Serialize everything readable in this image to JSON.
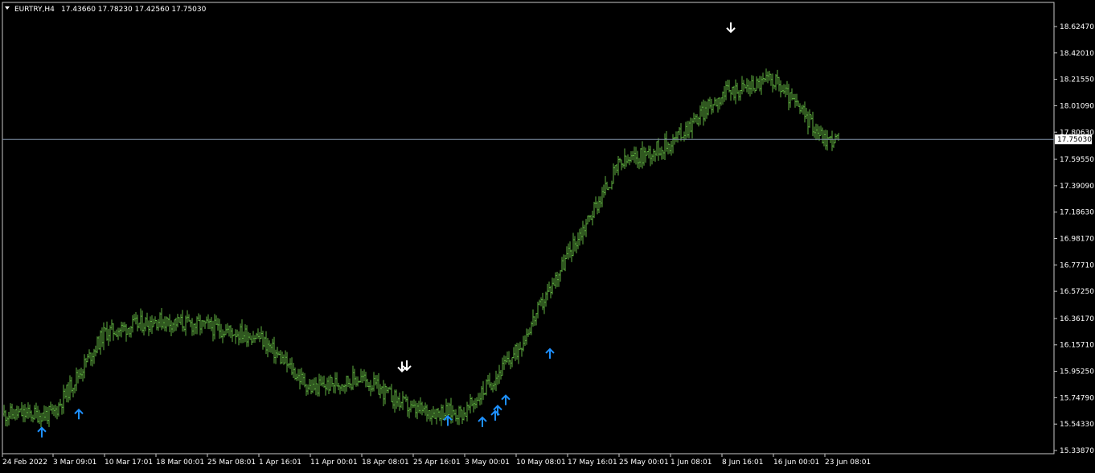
{
  "header": {
    "symbol_timeframe": "EURTRY,H4",
    "ohlc": "17.43660 17.78230 17.42560 17.75030"
  },
  "colors": {
    "background": "#000000",
    "bars": "#5fb040",
    "axis": "#c8c8c8",
    "text": "#ffffff",
    "price_line": "#7f8fa6",
    "buy_arrow": "#1e90ff",
    "sell_arrow": "#ffffff"
  },
  "chart_data": {
    "type": "ohlc-bar",
    "title": "EURTRY,H4",
    "y_ticks": [
      "18.62470",
      "18.42010",
      "18.21550",
      "18.01090",
      "17.80630",
      "17.59550",
      "17.39090",
      "17.18630",
      "16.98170",
      "16.77710",
      "16.57250",
      "16.36170",
      "16.15710",
      "15.95250",
      "15.74790",
      "15.54330",
      "15.33870"
    ],
    "x_ticks": [
      "24 Feb 2022",
      "3 Mar 09:01",
      "10 Mar 17:01",
      "18 Mar 00:01",
      "25 Mar 08:01",
      "1 Apr 16:01",
      "11 Apr 00:01",
      "18 Apr 08:01",
      "25 Apr 16:01",
      "3 May 00:01",
      "10 May 08:01",
      "17 May 16:01",
      "25 May 00:01",
      "1 Jun 08:01",
      "8 Jun 16:01",
      "16 Jun 00:01",
      "23 Jun 08:01"
    ],
    "ylim": [
      15.3387,
      18.6247
    ],
    "current_price": "17.75030",
    "price_path": [
      {
        "x": "24 Feb 2022",
        "y": 15.62
      },
      {
        "x": "3 Mar 09:01",
        "y": 15.62
      },
      {
        "x": "10 Mar 17:01",
        "y": 16.25
      },
      {
        "x": "18 Mar 00:01",
        "y": 16.35
      },
      {
        "x": "25 Mar 08:01",
        "y": 16.3
      },
      {
        "x": "1 Apr 16:01",
        "y": 16.22
      },
      {
        "x": "11 Apr 00:01",
        "y": 15.82
      },
      {
        "x": "18 Apr 08:01",
        "y": 15.9
      },
      {
        "x": "25 Apr 16:01",
        "y": 15.65
      },
      {
        "x": "3 May 00:01",
        "y": 15.63
      },
      {
        "x": "10 May 08:01",
        "y": 16.1
      },
      {
        "x": "17 May 16:01",
        "y": 16.85
      },
      {
        "x": "25 May 00:01",
        "y": 17.55
      },
      {
        "x": "1 Jun 08:01",
        "y": 17.72
      },
      {
        "x": "8 Jun 16:01",
        "y": 18.1
      },
      {
        "x": "16 Jun 00:01",
        "y": 18.22
      },
      {
        "x": "23 Jun 08:01",
        "y": 17.75
      }
    ],
    "arrows": {
      "buy": [
        15.44,
        15.58,
        15.53,
        15.52,
        15.57,
        15.61,
        15.69,
        16.05
      ],
      "sell": [
        15.99,
        16.0,
        18.62
      ]
    }
  }
}
